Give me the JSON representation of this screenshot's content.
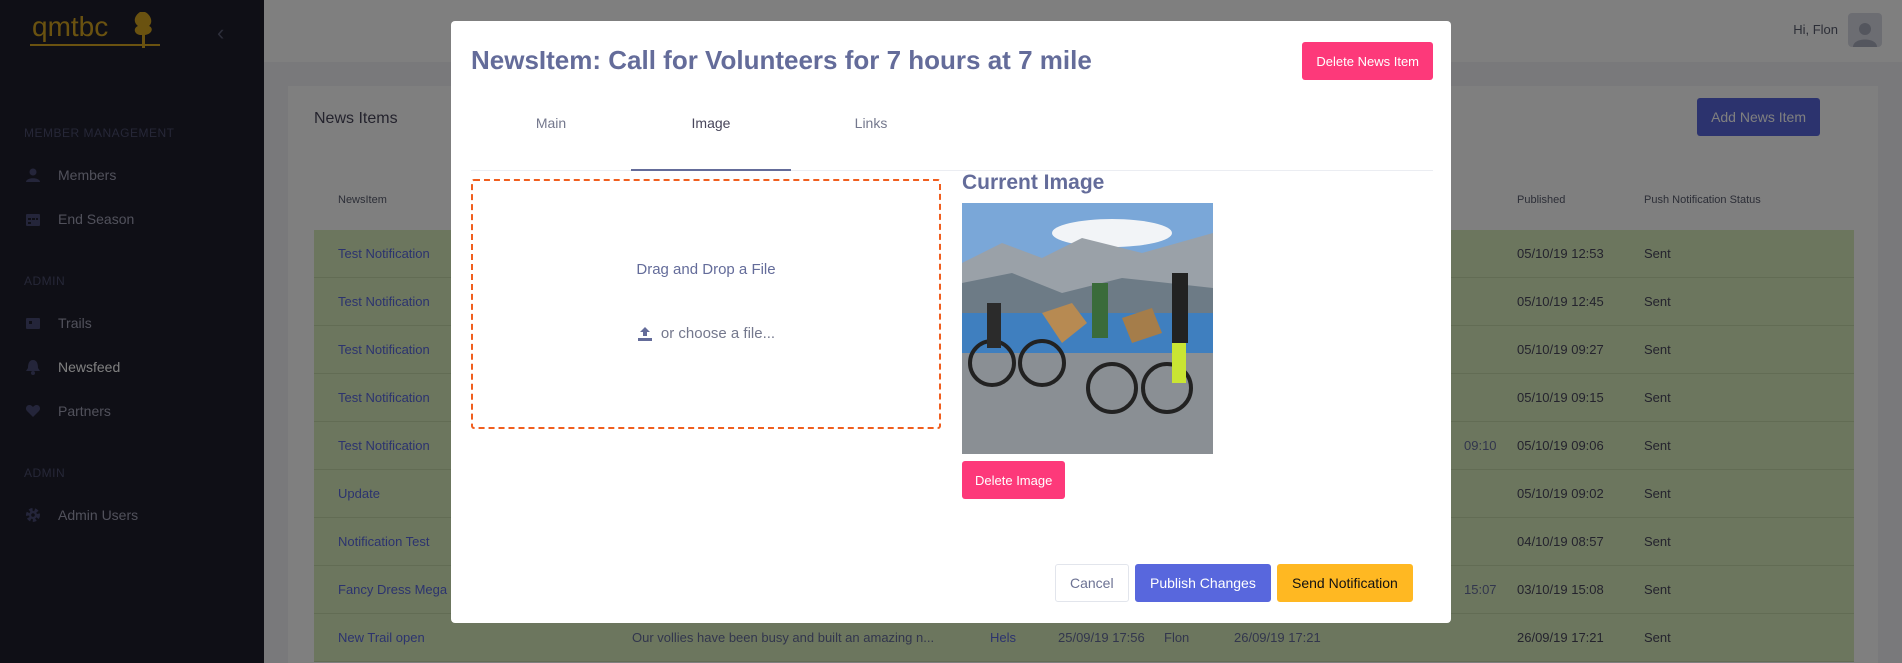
{
  "sidebar": {
    "logo_text": "qmtbc",
    "sections": [
      {
        "title": "MEMBER MANAGEMENT",
        "items": [
          {
            "label": "Members",
            "icon": "user-icon"
          },
          {
            "label": "End Season",
            "icon": "calendar-icon"
          }
        ]
      },
      {
        "title": "ADMIN",
        "items": [
          {
            "label": "Trails",
            "icon": "map-icon"
          },
          {
            "label": "Newsfeed",
            "icon": "bell-icon"
          },
          {
            "label": "Partners",
            "icon": "heart-icon"
          }
        ]
      },
      {
        "title": "ADMIN",
        "items": [
          {
            "label": "Admin Users",
            "icon": "gear-icon"
          }
        ]
      }
    ]
  },
  "header": {
    "greeting": "Hi, Flon"
  },
  "card": {
    "title": "News Items",
    "add_button": "Add News Item",
    "columns": [
      "NewsItem",
      "Published",
      "Push Notification Status"
    ],
    "rows": [
      {
        "title": "Test Notification",
        "published": "05/10/19 12:53",
        "status": "Sent"
      },
      {
        "title": "Test Notification",
        "published": "05/10/19 12:45",
        "status": "Sent"
      },
      {
        "title": "Test Notification",
        "published": "05/10/19 09:27",
        "status": "Sent"
      },
      {
        "title": "Test Notification",
        "published": "05/10/19 09:15",
        "status": "Sent"
      },
      {
        "title": "Test Notification",
        "extra": "09:10",
        "published": "05/10/19 09:06",
        "status": "Sent"
      },
      {
        "title": "Update",
        "published": "05/10/19 09:02",
        "status": "Sent"
      },
      {
        "title": "Notification Test",
        "published": "04/10/19 08:57",
        "status": "Sent"
      },
      {
        "title": "Fancy Dress Mega",
        "extra": "15:07",
        "published": "03/10/19 15:08",
        "status": "Sent"
      },
      {
        "title": "New Trail open",
        "excerpt": "Our vollies have been busy and built an amazing n...",
        "author": "Hels",
        "created": "25/09/19 17:56",
        "editor": "Flon",
        "updated": "26/09/19 17:21",
        "published": "26/09/19 17:21",
        "status": "Sent"
      }
    ]
  },
  "modal": {
    "title": "NewsItem: Call for Volunteers for 7 hours at 7 mile",
    "delete_button": "Delete News Item",
    "tabs": [
      "Main",
      "Image",
      "Links"
    ],
    "active_tab": "Image",
    "dropzone": {
      "primary": "Drag and Drop a File",
      "secondary": "or choose a file..."
    },
    "current_image_title": "Current Image",
    "delete_image_button": "Delete Image",
    "footer": {
      "cancel": "Cancel",
      "publish": "Publish Changes",
      "notify": "Send Notification"
    }
  },
  "colors": {
    "primary": "#5867dd",
    "danger": "#fd397a",
    "warning": "#ffb822",
    "dropzone_border": "#f05e1e",
    "sidebar": "#1e1e2d",
    "row": "#d8ecbd"
  }
}
